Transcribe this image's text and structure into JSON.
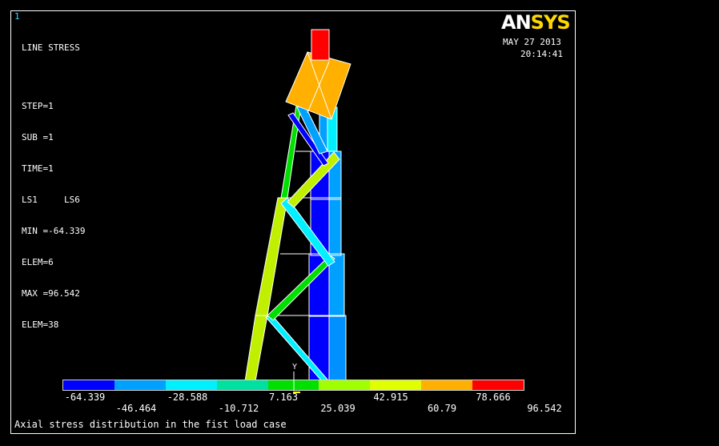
{
  "window_number": "1",
  "plot": {
    "title": "LINE STRESS",
    "info_lines": [
      "STEP=1",
      "SUB =1",
      "TIME=1",
      "LS1     LS6",
      "MIN =-64.339",
      "ELEM=6",
      "MAX =96.542",
      "ELEM=38"
    ]
  },
  "logo": {
    "part1": "AN",
    "part2": "SYS"
  },
  "date": "MAY 27 2013",
  "time": "20:14:41",
  "legend": {
    "colors": [
      "#0000ff",
      "#00a0ff",
      "#00f0ff",
      "#00e0a0",
      "#00e000",
      "#a0ff00",
      "#e0ff00",
      "#ffb000",
      "#ff0000"
    ],
    "values": [
      "-64.339",
      "-46.464",
      "-28.588",
      "-10.712",
      "7.163",
      "25.039",
      "42.915",
      "60.79",
      "78.666",
      "96.542"
    ]
  },
  "axis_label": "Y",
  "caption": "Axial stress distribution in the fist load case",
  "colors": {
    "outline": "#ffffff",
    "logo_sys": "#ffd700",
    "window_number": "#3fd9ff"
  }
}
